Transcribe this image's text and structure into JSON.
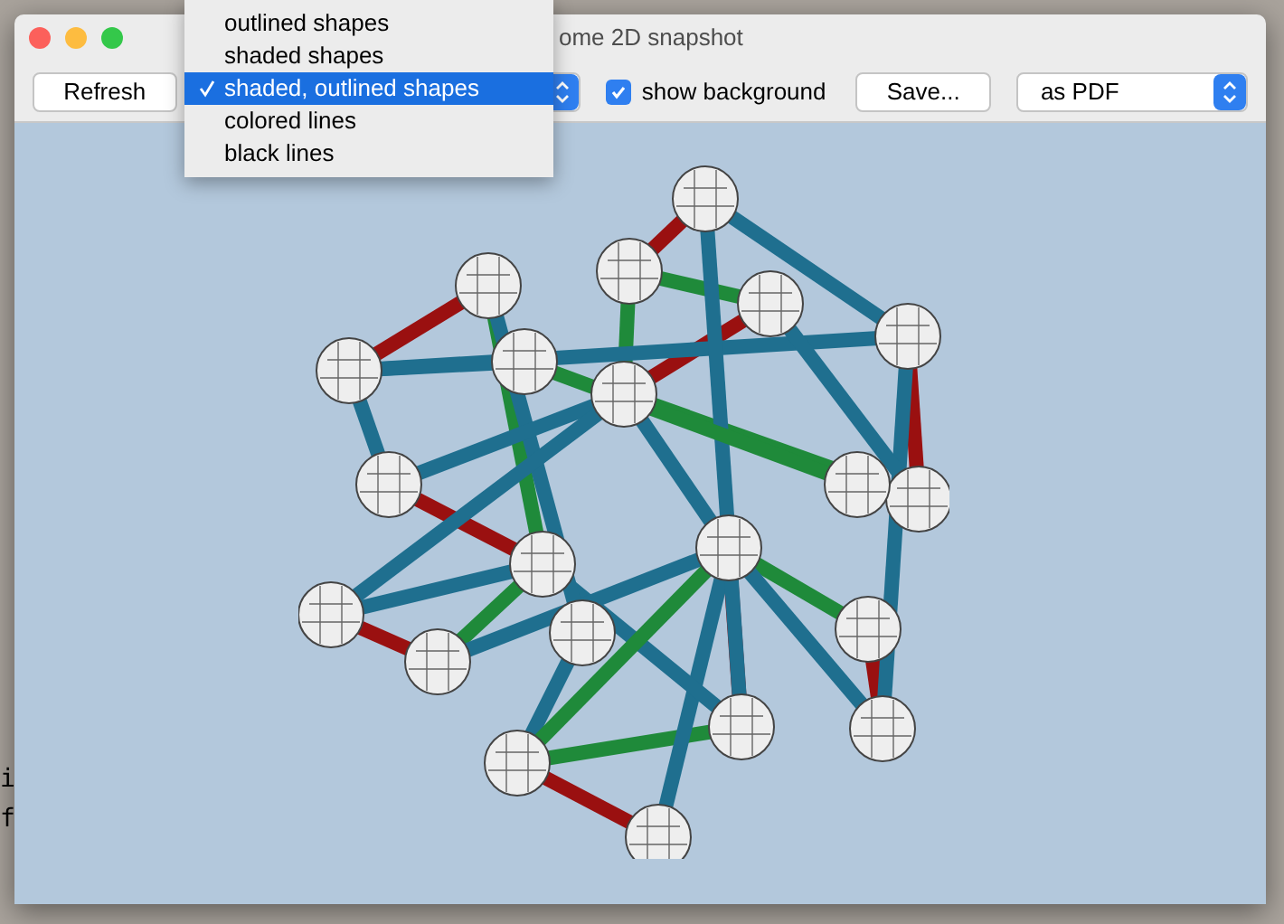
{
  "window": {
    "title": "ome 2D snapshot"
  },
  "toolbar": {
    "refresh_button": "Refresh",
    "show_background": {
      "label": "show background",
      "checked": true
    },
    "save_button": "Save...",
    "format_select": {
      "value": "as PDF"
    }
  },
  "style_menu": {
    "items": [
      {
        "label": "outlined shapes",
        "selected": false
      },
      {
        "label": "shaded shapes",
        "selected": false
      },
      {
        "label": "shaded, outlined shapes",
        "selected": true
      },
      {
        "label": "colored lines",
        "selected": false
      },
      {
        "label": "black lines",
        "selected": false
      }
    ]
  },
  "background_text": [
    "i",
    "f"
  ]
}
